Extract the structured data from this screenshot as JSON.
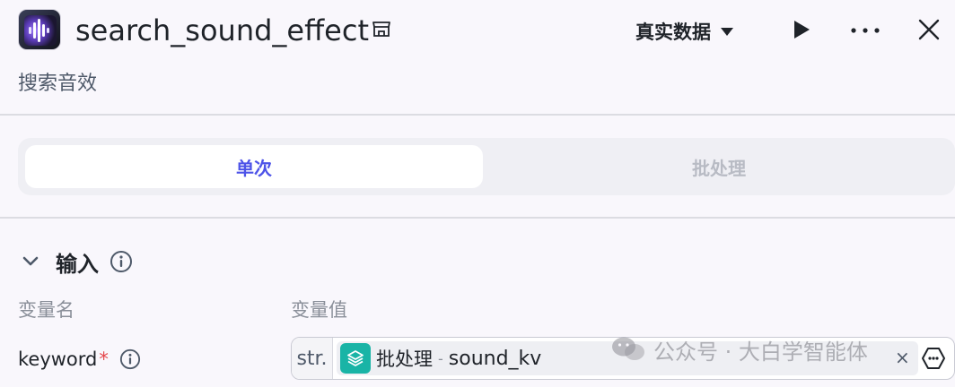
{
  "header": {
    "title": "search_sound_effect",
    "description": "搜索音效",
    "data_source_label": "真实数据",
    "icons": {
      "app": "sound-wave-app-icon",
      "store": "store-icon",
      "dropdown": "caret-down-icon",
      "run": "play-icon",
      "more": "more-horizontal-icon",
      "close": "close-icon"
    }
  },
  "mode_tabs": [
    {
      "label": "单次",
      "active": true
    },
    {
      "label": "批处理",
      "active": false
    }
  ],
  "input_section": {
    "title": "输入",
    "col_name_label": "变量名",
    "col_value_label": "变量值",
    "params": [
      {
        "name": "keyword",
        "required_mark": "*",
        "type_tag": "str.",
        "ref_node": "批处理",
        "ref_separator": "-",
        "ref_var": "sound_kv"
      }
    ]
  },
  "watermark": {
    "text": "公众号 · 大白学智能体",
    "icon": "wechat-icon"
  },
  "colors": {
    "accent": "#4d53e8",
    "node_icon": "#19b4a6",
    "required": "#e5484d",
    "background": "#f9f7fc"
  }
}
